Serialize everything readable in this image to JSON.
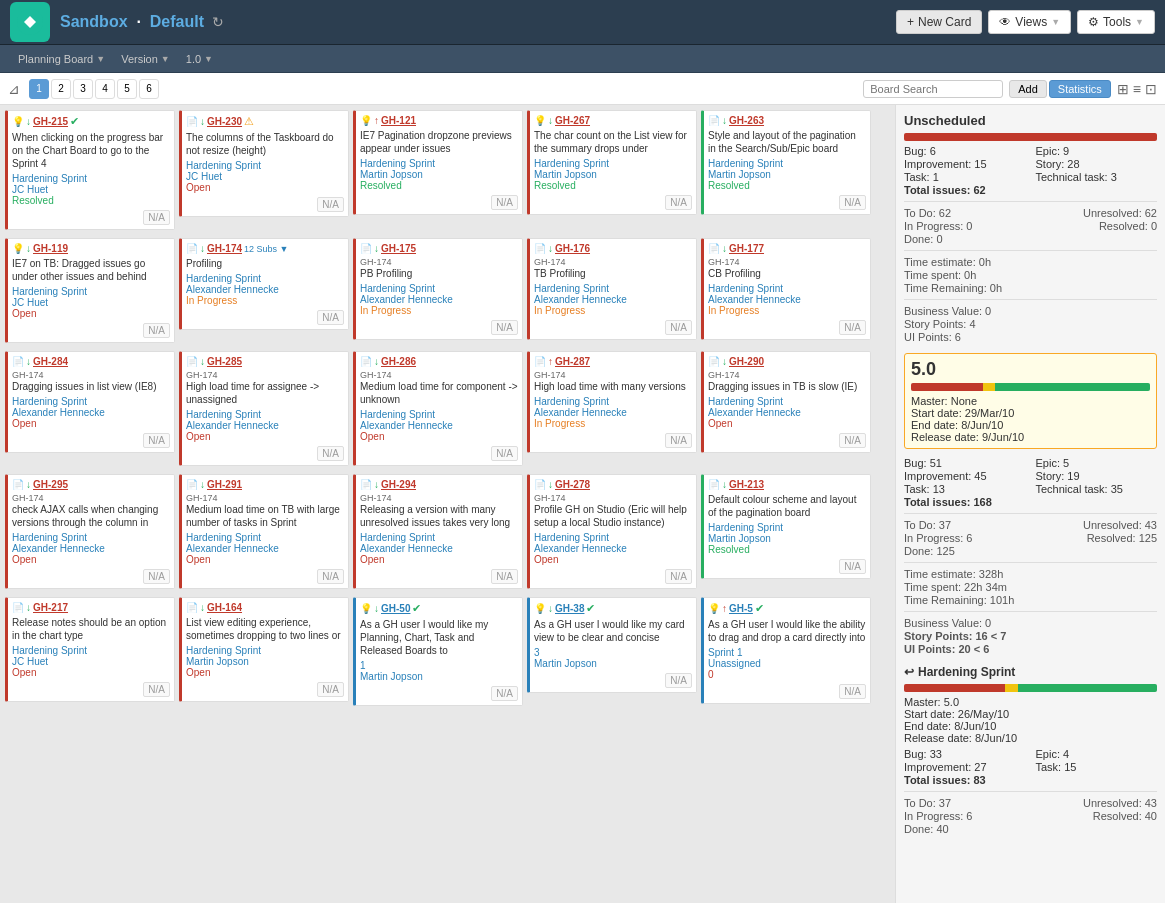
{
  "app": {
    "name": "Sandbox",
    "workspace": "Default",
    "nav": "Planning Board",
    "version_label": "Version",
    "version": "1.0"
  },
  "header": {
    "new_card": "New Card",
    "views": "Views",
    "tools": "Tools"
  },
  "toolbar": {
    "pages": [
      "1",
      "2",
      "3",
      "4",
      "5",
      "6"
    ],
    "active_page": "1",
    "search_placeholder": "Board Search",
    "add_label": "Add",
    "stats_label": "Statistics"
  },
  "cards": [
    {
      "id": "GH-215",
      "icon": "💡",
      "color": "red-left",
      "title": "When clicking on the progress bar on the Chart Board to go to the Sprint 4",
      "sprint": "Hardening Sprint",
      "person": "JC Huet",
      "status": "Resolved",
      "status_class": "resolved",
      "arrow": "down",
      "check": true,
      "sub": "",
      "na": "N/A"
    },
    {
      "id": "GH-230",
      "icon": "📄",
      "color": "red-left",
      "title": "The columns of the Taskboard do not resize (height)",
      "sprint": "Hardening Sprint",
      "person": "JC Huet",
      "status": "Open",
      "status_class": "open",
      "arrow": "down",
      "warn": true,
      "sub": "",
      "na": "N/A"
    },
    {
      "id": "GH-121",
      "icon": "💡",
      "color": "red-left",
      "title": "IE7 Pagination dropzone previews appear under issues",
      "sprint": "Hardening Sprint",
      "person": "Martin Jopson",
      "status": "Resolved",
      "status_class": "resolved",
      "arrow": "up",
      "sub": "",
      "na": "N/A"
    },
    {
      "id": "GH-267",
      "icon": "💡",
      "color": "red-left",
      "title": "The char count on the List view for the summary drops under",
      "sprint": "Hardening Sprint",
      "person": "Martin Jopson",
      "status": "Resolved",
      "status_class": "resolved",
      "arrow": "down",
      "sub": "",
      "na": "N/A"
    },
    {
      "id": "GH-263",
      "icon": "📄",
      "color": "green-left",
      "title": "Style and layout of the pagination in the Search/Sub/Epic board",
      "sprint": "Hardening Sprint",
      "person": "Martin Jopson",
      "status": "Resolved",
      "status_class": "resolved",
      "arrow": "down",
      "sub": "",
      "na": "N/A"
    },
    {
      "id": "GH-119",
      "icon": "💡",
      "color": "red-left",
      "title": "IE7 on TB: Dragged issues go under other issues and behind",
      "sprint": "Hardening Sprint",
      "person": "JC Huet",
      "status": "Open",
      "status_class": "open",
      "arrow": "down",
      "sub": "",
      "na": "N/A"
    },
    {
      "id": "GH-174",
      "icon": "📄",
      "color": "red-left",
      "title": "Profiling",
      "sprint": "Hardening Sprint",
      "person": "Alexander Hennecke",
      "status": "In Progress",
      "status_class": "in-progress",
      "arrow": "down",
      "sub": "12 Subs",
      "na": "N/A"
    },
    {
      "id": "GH-175",
      "icon": "📄",
      "color": "red-left",
      "title": "PB Profiling",
      "sprint": "Hardening Sprint",
      "person": "Alexander Hennecke",
      "status": "In Progress",
      "status_class": "in-progress",
      "arrow": "down",
      "sub": "GH-174",
      "na": "N/A"
    },
    {
      "id": "GH-176",
      "icon": "📄",
      "color": "red-left",
      "title": "TB Profiling",
      "sprint": "Hardening Sprint",
      "person": "Alexander Hennecke",
      "status": "In Progress",
      "status_class": "in-progress",
      "arrow": "down",
      "sub": "GH-174",
      "na": "N/A"
    },
    {
      "id": "GH-177",
      "icon": "📄",
      "color": "red-left",
      "title": "CB Profiling",
      "sprint": "Hardening Sprint",
      "person": "Alexander Hennecke",
      "status": "In Progress",
      "status_class": "in-progress",
      "arrow": "down",
      "sub": "GH-174",
      "na": "N/A"
    },
    {
      "id": "GH-284",
      "icon": "📄",
      "color": "red-left",
      "title": "Dragging issues in list view (IE8)",
      "sprint": "Hardening Sprint",
      "person": "Alexander Hennecke",
      "status": "Open",
      "status_class": "open",
      "arrow": "down",
      "sub": "GH-174",
      "na": "N/A"
    },
    {
      "id": "GH-285",
      "icon": "📄",
      "color": "red-left",
      "title": "High load time for assignee -> unassigned",
      "sprint": "Hardening Sprint",
      "person": "Alexander Hennecke",
      "status": "Open",
      "status_class": "open",
      "arrow": "down",
      "sub": "GH-174",
      "na": "N/A"
    },
    {
      "id": "GH-286",
      "icon": "📄",
      "color": "red-left",
      "title": "Medium load time for component -> unknown",
      "sprint": "Hardening Sprint",
      "person": "Alexander Hennecke",
      "status": "Open",
      "status_class": "open",
      "arrow": "down",
      "sub": "GH-174",
      "na": "N/A"
    },
    {
      "id": "GH-287",
      "icon": "📄",
      "color": "red-left",
      "title": "High load time with many versions",
      "sprint": "Hardening Sprint",
      "person": "Alexander Hennecke",
      "status": "In Progress",
      "status_class": "in-progress",
      "arrow": "up",
      "sub": "GH-174",
      "na": "N/A"
    },
    {
      "id": "GH-290",
      "icon": "📄",
      "color": "red-left",
      "title": "Dragging issues in TB is slow (IE)",
      "sprint": "Hardening Sprint",
      "person": "Alexander Hennecke",
      "status": "Open",
      "status_class": "open",
      "arrow": "down",
      "sub": "GH-174",
      "na": "N/A"
    },
    {
      "id": "GH-295",
      "icon": "📄",
      "color": "red-left",
      "title": "check AJAX calls when changing versions through the column in",
      "sprint": "Hardening Sprint",
      "person": "Alexander Hennecke",
      "status": "Open",
      "status_class": "open",
      "arrow": "down",
      "sub": "GH-174",
      "na": "N/A"
    },
    {
      "id": "GH-291",
      "icon": "📄",
      "color": "red-left",
      "title": "Medium load time on TB with large number of tasks in Sprint",
      "sprint": "Hardening Sprint",
      "person": "Alexander Hennecke",
      "status": "Open",
      "status_class": "open",
      "arrow": "down",
      "sub": "GH-174",
      "na": "N/A"
    },
    {
      "id": "GH-294",
      "icon": "📄",
      "color": "red-left",
      "title": "Releasing a version with many unresolved issues takes very long",
      "sprint": "Hardening Sprint",
      "person": "Alexander Hennecke",
      "status": "Open",
      "status_class": "open",
      "arrow": "down",
      "sub": "GH-174",
      "na": "N/A"
    },
    {
      "id": "GH-278",
      "icon": "📄",
      "color": "red-left",
      "title": "Profile GH on Studio (Eric will help setup a local Studio instance)",
      "sprint": "Hardening Sprint",
      "person": "Alexander Hennecke",
      "status": "Open",
      "status_class": "open",
      "arrow": "down",
      "sub": "GH-174",
      "na": "N/A"
    },
    {
      "id": "GH-213",
      "icon": "📄",
      "color": "green-left",
      "title": "Default colour scheme and layout of the pagination board",
      "sprint": "Hardening Sprint",
      "person": "Martin Jopson",
      "status": "Resolved",
      "status_class": "resolved",
      "arrow": "down",
      "sub": "",
      "na": "N/A"
    },
    {
      "id": "GH-217",
      "icon": "📄",
      "color": "red-left",
      "title": "Release notes should be an option in the chart type",
      "sprint": "Hardening Sprint",
      "person": "JC Huet",
      "status": "Open",
      "status_class": "open",
      "arrow": "down",
      "sub": "",
      "na": "N/A"
    },
    {
      "id": "GH-164",
      "icon": "📄",
      "color": "red-left",
      "title": "List view editing experience, sometimes dropping to two lines or",
      "sprint": "Hardening Sprint",
      "person": "Martin Jopson",
      "status": "Open",
      "status_class": "open",
      "arrow": "down",
      "sub": "",
      "na": "N/A"
    },
    {
      "id": "GH-50",
      "icon": "💡",
      "color": "blue-left",
      "title": "As a GH user I would like my Planning, Chart, Task and Released Boards to",
      "sprint": "1",
      "person": "Martin Jopson",
      "status": "",
      "status_class": "",
      "arrow": "down",
      "check": true,
      "sub": "",
      "na": "N/A"
    },
    {
      "id": "GH-38",
      "icon": "💡",
      "color": "blue-left",
      "title": "As a GH user I would like my card view to be clear and concise",
      "sprint": "3",
      "person": "Martin Jopson",
      "status": "",
      "status_class": "",
      "arrow": "down",
      "check": true,
      "sub": "",
      "na": "N/A"
    },
    {
      "id": "GH-5",
      "icon": "💡",
      "color": "blue-left",
      "title": "As a GH user I would like the ability to drag and drop a card directly into",
      "sprint": "Sprint 1",
      "person": "Unassigned",
      "status": "0",
      "status_class": "",
      "arrow": "up",
      "check": true,
      "sub": "",
      "na": "N/A"
    }
  ],
  "unscheduled": {
    "title": "Unscheduled",
    "stats": {
      "bug": "Bug: 6",
      "epic": "Epic: 9",
      "improvement": "Improvement: 15",
      "story": "Story: 28",
      "task": "Task: 1",
      "tech_task": "Technical task: 3",
      "total": "Total issues: 62",
      "todo": "To Do: 62",
      "unresolved": "Unresolved: 62",
      "in_progress": "In Progress: 0",
      "resolved_r": "Resolved: 0",
      "done": "Done: 0",
      "time_est": "Time estimate: 0h",
      "time_spent": "Time spent: 0h",
      "time_rem": "Time Remaining: 0h",
      "bv": "Business Value: 0",
      "sp": "Story Points: 4",
      "ui": "UI Points: 6"
    }
  },
  "sprint_50": {
    "version": "5.0",
    "stats": {
      "master": "Master: None",
      "start": "Start date: 29/Mar/10",
      "end": "End date: 8/Jun/10",
      "release": "Release date: 9/Jun/10",
      "bug": "Bug: 51",
      "epic": "Epic: 5",
      "improvement": "Improvement: 45",
      "story": "Story: 19",
      "task": "Task: 13",
      "tech_task": "Technical task: 35",
      "total": "Total issues: 168",
      "todo": "To Do: 37",
      "unresolved": "Unresolved: 43",
      "in_progress": "In Progress: 6",
      "resolved_r": "Resolved: 125",
      "done": "Done: 125",
      "time_est": "Time estimate: 328h",
      "time_spent": "Time spent: 22h 34m",
      "time_rem": "Time Remaining: 101h",
      "bv": "Business Value: 0",
      "sp": "Story Points: 16 < 7",
      "ui": "UI Points: 20 < 6"
    }
  },
  "sprint_hardening": {
    "name": "↩ Hardening Sprint",
    "stats": {
      "master": "Master: 5.0",
      "start": "Start date: 26/May/10",
      "end": "End date: 8/Jun/10",
      "release": "Release date: 8/Jun/10",
      "bug": "Bug: 33",
      "epic": "Epic: 4",
      "improvement": "Improvement: 27",
      "task": "Task: 15",
      "total": "Total issues: 83",
      "todo": "To Do: 37",
      "unresolved": "Unresolved: 43",
      "in_progress": "In Progress: 6",
      "resolved_r": "Resolved: 40",
      "done": "Done: 40"
    }
  }
}
